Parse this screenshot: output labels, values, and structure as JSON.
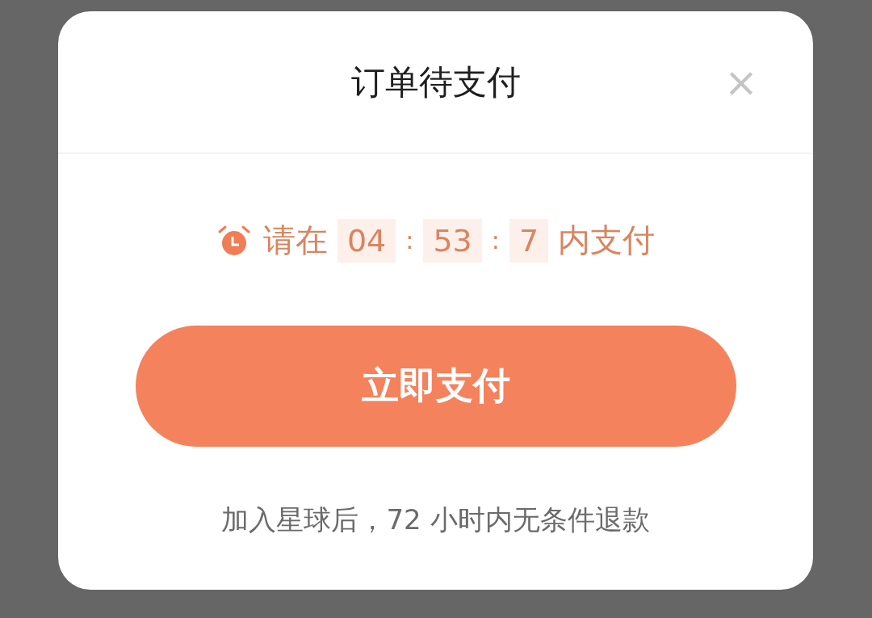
{
  "dialog": {
    "title": "订单待支付",
    "close": "×",
    "countdown": {
      "prefix": "请在",
      "hours": "04",
      "separator_1": ":",
      "minutes": "53",
      "separator_2": ":",
      "seconds": "7",
      "suffix": "内支付"
    },
    "pay_button": "立即支付",
    "note": "加入星球后，72 小时内无条件退款"
  }
}
